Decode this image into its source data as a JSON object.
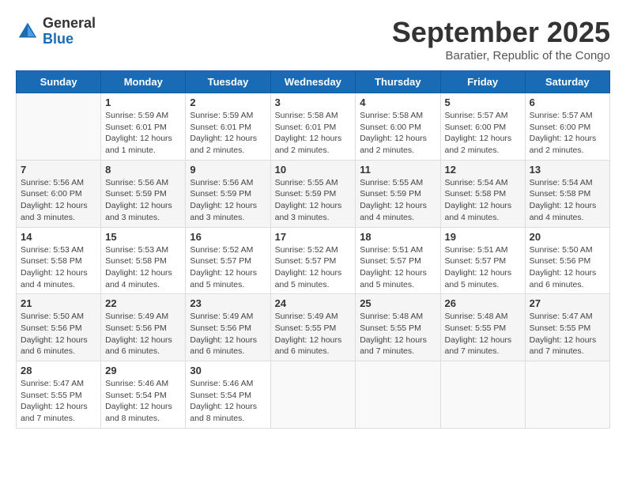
{
  "header": {
    "logo": {
      "general": "General",
      "blue": "Blue"
    },
    "title": "September 2025",
    "subtitle": "Baratier, Republic of the Congo"
  },
  "weekdays": [
    "Sunday",
    "Monday",
    "Tuesday",
    "Wednesday",
    "Thursday",
    "Friday",
    "Saturday"
  ],
  "weeks": [
    [
      {
        "day": "",
        "info": ""
      },
      {
        "day": "1",
        "info": "Sunrise: 5:59 AM\nSunset: 6:01 PM\nDaylight: 12 hours\nand 1 minute."
      },
      {
        "day": "2",
        "info": "Sunrise: 5:59 AM\nSunset: 6:01 PM\nDaylight: 12 hours\nand 2 minutes."
      },
      {
        "day": "3",
        "info": "Sunrise: 5:58 AM\nSunset: 6:01 PM\nDaylight: 12 hours\nand 2 minutes."
      },
      {
        "day": "4",
        "info": "Sunrise: 5:58 AM\nSunset: 6:00 PM\nDaylight: 12 hours\nand 2 minutes."
      },
      {
        "day": "5",
        "info": "Sunrise: 5:57 AM\nSunset: 6:00 PM\nDaylight: 12 hours\nand 2 minutes."
      },
      {
        "day": "6",
        "info": "Sunrise: 5:57 AM\nSunset: 6:00 PM\nDaylight: 12 hours\nand 2 minutes."
      }
    ],
    [
      {
        "day": "7",
        "info": "Sunrise: 5:56 AM\nSunset: 6:00 PM\nDaylight: 12 hours\nand 3 minutes."
      },
      {
        "day": "8",
        "info": "Sunrise: 5:56 AM\nSunset: 5:59 PM\nDaylight: 12 hours\nand 3 minutes."
      },
      {
        "day": "9",
        "info": "Sunrise: 5:56 AM\nSunset: 5:59 PM\nDaylight: 12 hours\nand 3 minutes."
      },
      {
        "day": "10",
        "info": "Sunrise: 5:55 AM\nSunset: 5:59 PM\nDaylight: 12 hours\nand 3 minutes."
      },
      {
        "day": "11",
        "info": "Sunrise: 5:55 AM\nSunset: 5:59 PM\nDaylight: 12 hours\nand 4 minutes."
      },
      {
        "day": "12",
        "info": "Sunrise: 5:54 AM\nSunset: 5:58 PM\nDaylight: 12 hours\nand 4 minutes."
      },
      {
        "day": "13",
        "info": "Sunrise: 5:54 AM\nSunset: 5:58 PM\nDaylight: 12 hours\nand 4 minutes."
      }
    ],
    [
      {
        "day": "14",
        "info": "Sunrise: 5:53 AM\nSunset: 5:58 PM\nDaylight: 12 hours\nand 4 minutes."
      },
      {
        "day": "15",
        "info": "Sunrise: 5:53 AM\nSunset: 5:58 PM\nDaylight: 12 hours\nand 4 minutes."
      },
      {
        "day": "16",
        "info": "Sunrise: 5:52 AM\nSunset: 5:57 PM\nDaylight: 12 hours\nand 5 minutes."
      },
      {
        "day": "17",
        "info": "Sunrise: 5:52 AM\nSunset: 5:57 PM\nDaylight: 12 hours\nand 5 minutes."
      },
      {
        "day": "18",
        "info": "Sunrise: 5:51 AM\nSunset: 5:57 PM\nDaylight: 12 hours\nand 5 minutes."
      },
      {
        "day": "19",
        "info": "Sunrise: 5:51 AM\nSunset: 5:57 PM\nDaylight: 12 hours\nand 5 minutes."
      },
      {
        "day": "20",
        "info": "Sunrise: 5:50 AM\nSunset: 5:56 PM\nDaylight: 12 hours\nand 6 minutes."
      }
    ],
    [
      {
        "day": "21",
        "info": "Sunrise: 5:50 AM\nSunset: 5:56 PM\nDaylight: 12 hours\nand 6 minutes."
      },
      {
        "day": "22",
        "info": "Sunrise: 5:49 AM\nSunset: 5:56 PM\nDaylight: 12 hours\nand 6 minutes."
      },
      {
        "day": "23",
        "info": "Sunrise: 5:49 AM\nSunset: 5:56 PM\nDaylight: 12 hours\nand 6 minutes."
      },
      {
        "day": "24",
        "info": "Sunrise: 5:49 AM\nSunset: 5:55 PM\nDaylight: 12 hours\nand 6 minutes."
      },
      {
        "day": "25",
        "info": "Sunrise: 5:48 AM\nSunset: 5:55 PM\nDaylight: 12 hours\nand 7 minutes."
      },
      {
        "day": "26",
        "info": "Sunrise: 5:48 AM\nSunset: 5:55 PM\nDaylight: 12 hours\nand 7 minutes."
      },
      {
        "day": "27",
        "info": "Sunrise: 5:47 AM\nSunset: 5:55 PM\nDaylight: 12 hours\nand 7 minutes."
      }
    ],
    [
      {
        "day": "28",
        "info": "Sunrise: 5:47 AM\nSunset: 5:55 PM\nDaylight: 12 hours\nand 7 minutes."
      },
      {
        "day": "29",
        "info": "Sunrise: 5:46 AM\nSunset: 5:54 PM\nDaylight: 12 hours\nand 8 minutes."
      },
      {
        "day": "30",
        "info": "Sunrise: 5:46 AM\nSunset: 5:54 PM\nDaylight: 12 hours\nand 8 minutes."
      },
      {
        "day": "",
        "info": ""
      },
      {
        "day": "",
        "info": ""
      },
      {
        "day": "",
        "info": ""
      },
      {
        "day": "",
        "info": ""
      }
    ]
  ]
}
